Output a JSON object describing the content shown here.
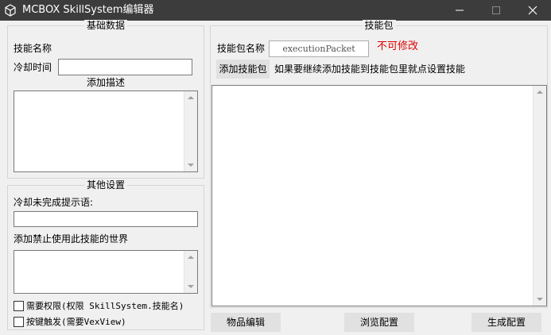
{
  "window": {
    "title": "MCBOX SkillSystem编辑器",
    "icons": {
      "app": "cube-icon",
      "minimize": "minimize-icon",
      "maximize": "maximize-icon",
      "close": "close-icon"
    }
  },
  "basic": {
    "legend": "基础数据",
    "skill_name_label": "技能名称",
    "cooldown_label": "冷却时间",
    "cooldown_value": "",
    "description_legend": "添加描述",
    "description_value": ""
  },
  "other": {
    "legend": "其他设置",
    "cooldown_msg_label": "冷却未完成提示语:",
    "cooldown_msg_value": "",
    "banned_worlds_label": "添加禁止使用此技能的世界",
    "banned_worlds_value": "",
    "require_permission_label": "需要权限(权限 SkillSystem.技能名)",
    "require_permission_checked": false,
    "key_trigger_label": "按键触发(需要VexView)",
    "key_trigger_checked": false
  },
  "packet": {
    "legend": "技能包",
    "name_label": "技能包名称",
    "name_value": "executionPacket",
    "readonly_note": "不可修改",
    "add_skill_button": "添加技能包",
    "hint": "如果要继续添加技能到技能包里就点设置技能",
    "list_value": ""
  },
  "footer": {
    "item_edit_button": "物品编辑",
    "browse_button": "浏览配置",
    "generate_button": "生成配置"
  },
  "colors": {
    "titlebar": "#3c3c3c",
    "warning_text": "#e00000"
  }
}
